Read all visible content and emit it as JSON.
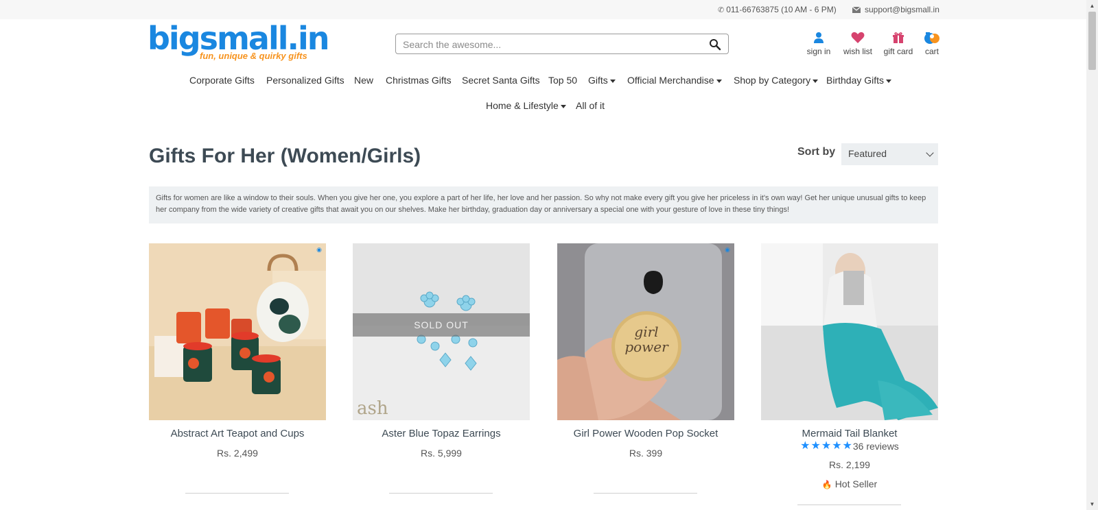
{
  "topbar": {
    "phone": "011-66763875 (10 AM - 6 PM)",
    "email": "support@bigsmall.in"
  },
  "logo": {
    "text": "bigsmall.in",
    "tagline": "fun, unique & quirky gifts"
  },
  "search": {
    "placeholder": "Search the awesome..."
  },
  "header_icons": {
    "sign_in": "sign in",
    "wish_list": "wish list",
    "gift_card": "gift card",
    "cart": "cart"
  },
  "nav": {
    "row1": [
      {
        "label": "Corporate Gifts",
        "dropdown": false
      },
      {
        "label": "Personalized Gifts",
        "dropdown": false
      },
      {
        "label": "New",
        "dropdown": false
      },
      {
        "label": "Christmas Gifts",
        "dropdown": false
      },
      {
        "label": "Secret Santa Gifts",
        "dropdown": false
      },
      {
        "label": "Top 50",
        "dropdown": false
      },
      {
        "label": "Gifts",
        "dropdown": true
      },
      {
        "label": "Official Merchandise",
        "dropdown": true
      },
      {
        "label": "Shop by Category",
        "dropdown": true
      },
      {
        "label": "Birthday Gifts",
        "dropdown": true
      }
    ],
    "row2": [
      {
        "label": "Home & Lifestyle",
        "dropdown": true
      },
      {
        "label": "All of it",
        "dropdown": false
      }
    ]
  },
  "page": {
    "title": "Gifts For Her (Women/Girls)",
    "sort_label": "Sort by",
    "sort_value": "Featured",
    "description": "Gifts for women are like a window to their souls. When you give her one, you explore a part of her life, her love and her passion. So why not make every gift you give her priceless in it's own way! Get her unique unusual gifts to keep her company from the wide variety of creative gifts that await you on our shelves. Make her birthday, graduation day or anniversary a special one with your gesture of love in these tiny things!"
  },
  "products": [
    {
      "name": "Abstract Art Teapot and Cups",
      "price": "Rs. 2,499"
    },
    {
      "name": "Aster Blue Topaz Earrings",
      "price": "Rs. 5,999",
      "overlay": "SOLD OUT",
      "watermark": "ash"
    },
    {
      "name": "Girl Power Wooden Pop Socket",
      "price": "Rs. 399",
      "overlay_text": "girl power"
    },
    {
      "name": "Mermaid Tail Blanket",
      "price": "Rs. 2,199",
      "rating": 5,
      "reviews": "36 reviews",
      "badge": "Hot Seller"
    }
  ],
  "colors": {
    "brand_blue": "#1a87e0",
    "brand_orange": "#f7931e",
    "star_blue": "#1e90ff"
  }
}
